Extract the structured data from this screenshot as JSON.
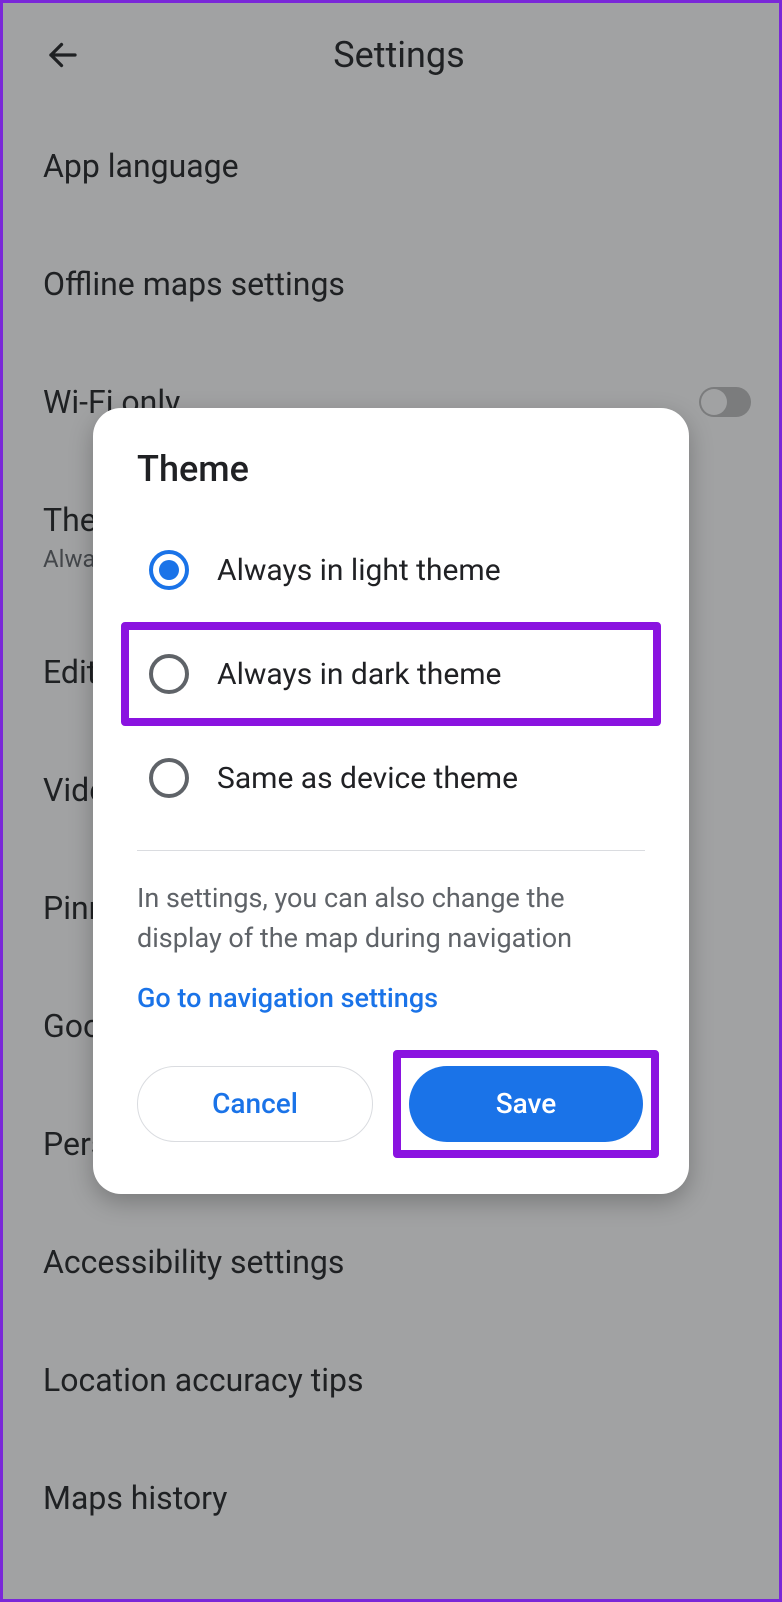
{
  "header": {
    "title": "Settings"
  },
  "settings_items": {
    "app_language": "App language",
    "offline_maps": "Offline maps settings",
    "wifi_only": "Wi-Fi only",
    "theme_label": "Theme",
    "theme_value": "Always in light theme",
    "edit_home_work": "Edit home or work",
    "video_settings": "Video settings",
    "pinned_trips": "Pinned trips",
    "google_assistant": "Google Assistant settings",
    "personal_content": "Personal content",
    "accessibility": "Accessibility settings",
    "location_tips": "Location accuracy tips",
    "maps_history": "Maps history"
  },
  "dialog": {
    "title": "Theme",
    "options": {
      "light": "Always in light theme",
      "dark": "Always in dark theme",
      "device": "Same as device theme"
    },
    "info": "In settings, you can also change the display of the map during navigation",
    "link": "Go to navigation settings",
    "cancel": "Cancel",
    "save": "Save"
  }
}
